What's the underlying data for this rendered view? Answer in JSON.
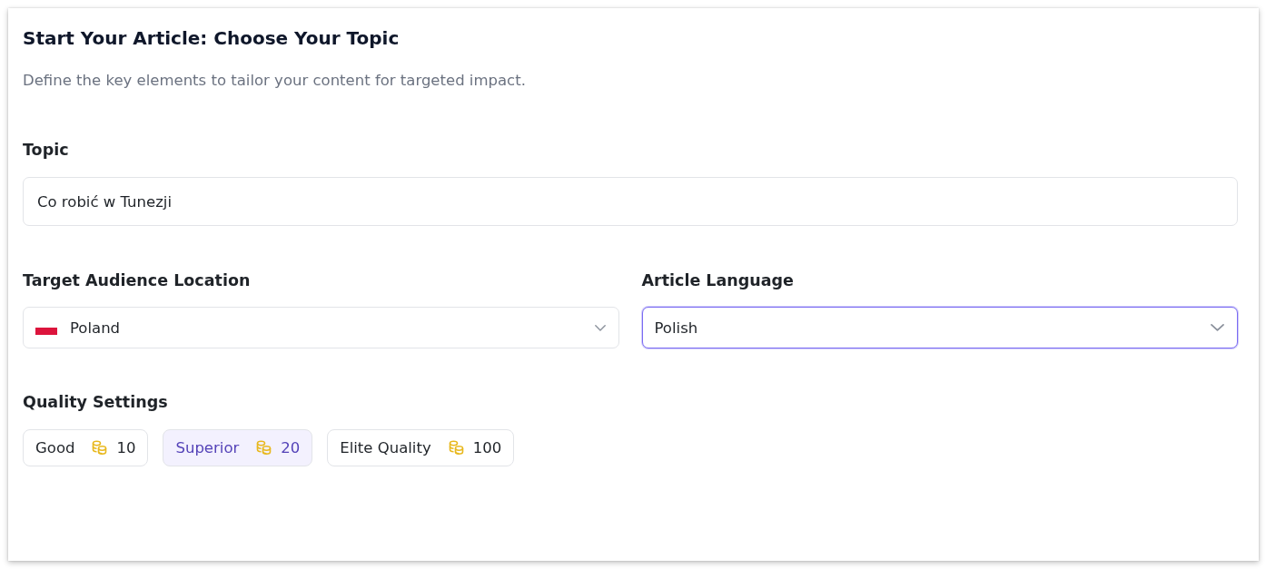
{
  "card": {
    "title": "Start Your Article: Choose Your Topic",
    "subtitle": "Define the key elements to tailor your content for targeted impact."
  },
  "topic": {
    "label": "Topic",
    "value": "Co robić w Tunezji"
  },
  "location": {
    "label": "Target Audience Location",
    "value": "Poland",
    "focused": false
  },
  "language": {
    "label": "Article Language",
    "value": "Polish",
    "focused": true
  },
  "quality": {
    "label": "Quality Settings",
    "options": [
      {
        "label": "Good",
        "cost": "10",
        "selected": false
      },
      {
        "label": "Superior",
        "cost": "20",
        "selected": true
      },
      {
        "label": "Elite Quality",
        "cost": "100",
        "selected": false
      }
    ]
  }
}
